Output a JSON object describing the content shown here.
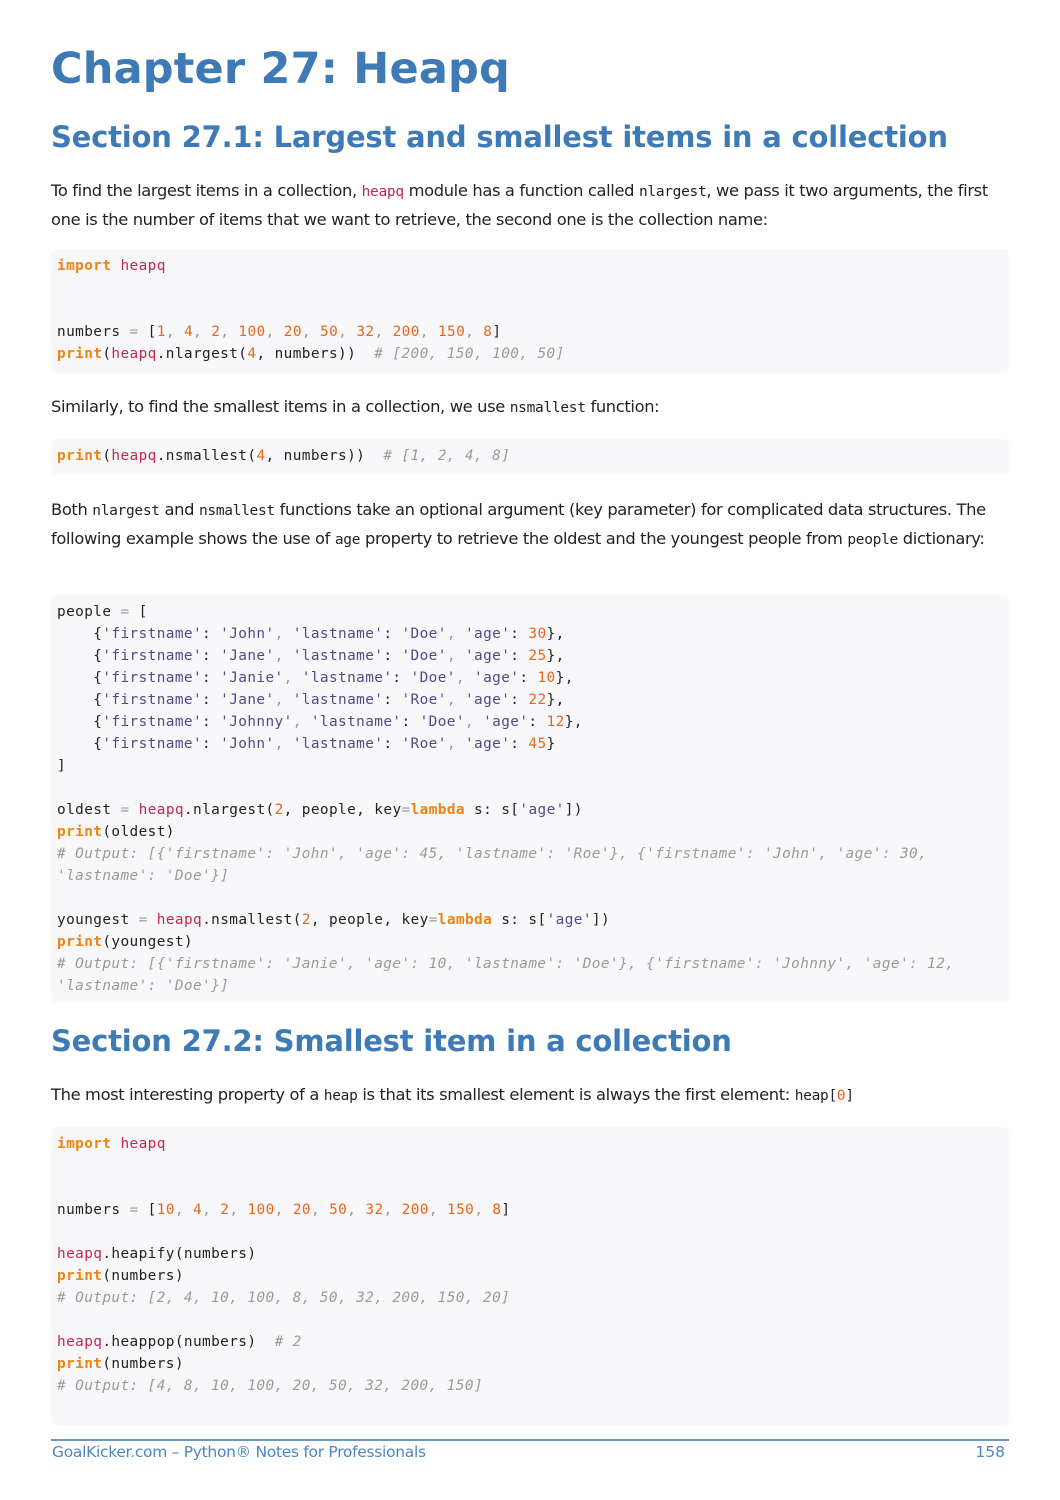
{
  "chapter": {
    "title": "Chapter 27: Heapq"
  },
  "sections": [
    {
      "title": "Section 27.1: Largest and smallest items in a collection",
      "intro": {
        "part1": "To find the largest items in a collection, ",
        "code1": "heapq",
        "part2": " module has a function called ",
        "code2": "nlargest",
        "part3": ", we pass it two arguments, the first one is the number of items that we want to retrieve, the second one is the collection name:"
      },
      "code_block_1": {
        "import_kw": "import",
        "import_mod": "heapq",
        "numbers_var": "numbers",
        "numbers_values": [
          "1",
          "4",
          "2",
          "100",
          "20",
          "50",
          "32",
          "200",
          "150",
          "8"
        ],
        "print_kw": "print",
        "call_mod": "heapq",
        "call_fn": ".nlargest(",
        "call_arg_num": "4",
        "call_rest": ", numbers))",
        "comment": "# [200, 150, 100, 50]"
      },
      "similarly": {
        "part1": "Similarly, to find the smallest items in a collection, we use ",
        "code": "nsmallest",
        "part2": " function:"
      },
      "code_block_2": {
        "print_kw": "print",
        "call_mod": "heapq",
        "call_fn": ".nsmallest(",
        "call_arg_num": "4",
        "call_rest": ", numbers))",
        "comment": "# [1, 2, 4, 8]"
      },
      "both": {
        "part1": "Both ",
        "code1": "nlargest",
        "part2": " and ",
        "code2": "nsmallest",
        "part3": " functions take an optional argument (key parameter) for complicated data structures. The following example shows the use of ",
        "code3": "age",
        "part4": " property to retrieve the oldest and the youngest people from ",
        "code4": "people",
        "part5": " dictionary:"
      },
      "code_block_3": {
        "people_var": "people",
        "people": [
          {
            "firstname": "John",
            "lastname": "Doe",
            "age": "30"
          },
          {
            "firstname": "Jane",
            "lastname": "Doe",
            "age": "25"
          },
          {
            "firstname": "Janie",
            "lastname": "Doe",
            "age": "10"
          },
          {
            "firstname": "Jane",
            "lastname": "Roe",
            "age": "22"
          },
          {
            "firstname": "Johnny",
            "lastname": "Doe",
            "age": "12"
          },
          {
            "firstname": "John",
            "lastname": "Roe",
            "age": "45"
          }
        ],
        "oldest": {
          "var": "oldest",
          "mod": "heapq",
          "fn": ".nlargest(",
          "num": "2",
          "mid": ", people, key",
          "lambda_kw": "lambda",
          "tail_pre": " s: s[",
          "key_str": "'age'",
          "tail_post": "])",
          "print_kw": "print",
          "print_arg": "(oldest)",
          "output_line1": "# Output: [{'firstname': 'John', 'age': 45, 'lastname': 'Roe'}, {'firstname': 'John', 'age': 30,",
          "output_line2": "'lastname': 'Doe'}]"
        },
        "youngest": {
          "var": "youngest",
          "mod": "heapq",
          "fn": ".nsmallest(",
          "num": "2",
          "mid": ", people, key",
          "lambda_kw": "lambda",
          "tail_pre": " s: s[",
          "key_str": "'age'",
          "tail_post": "])",
          "print_kw": "print",
          "print_arg": "(youngest)",
          "output_line1": "# Output: [{'firstname': 'Janie', 'age': 10, 'lastname': 'Doe'}, {'firstname': 'Johnny', 'age': 12,",
          "output_line2": "'lastname': 'Doe'}]"
        }
      }
    },
    {
      "title": "Section 27.2: Smallest item in a collection",
      "intro": {
        "part1": "The most interesting property of a ",
        "code1": "heap",
        "part2": " is that its smallest element is always the first element: ",
        "code2_pre": "heap[",
        "code2_num": "0",
        "code2_post": "]"
      },
      "code_block_4": {
        "import_kw": "import",
        "import_mod": "heapq",
        "numbers_var": "numbers",
        "numbers_values": [
          "10",
          "4",
          "2",
          "100",
          "20",
          "50",
          "32",
          "200",
          "150",
          "8"
        ],
        "heapify_mod": "heapq",
        "heapify_call": ".heapify(numbers)",
        "print_kw": "print",
        "print_arg": "(numbers)",
        "output1": "# Output: [2, 4, 10, 100, 8, 50, 32, 200, 150, 20]",
        "heappop_mod": "heapq",
        "heappop_call": ".heappop(numbers)",
        "heappop_comment": "# 2",
        "print2_kw": "print",
        "print2_arg": "(numbers)",
        "output2": "# Output: [4, 8, 10, 100, 20, 50, 32, 200, 150]"
      }
    }
  ],
  "footer": {
    "left": "GoalKicker.com – Python® Notes for Professionals",
    "page_number": "158"
  }
}
